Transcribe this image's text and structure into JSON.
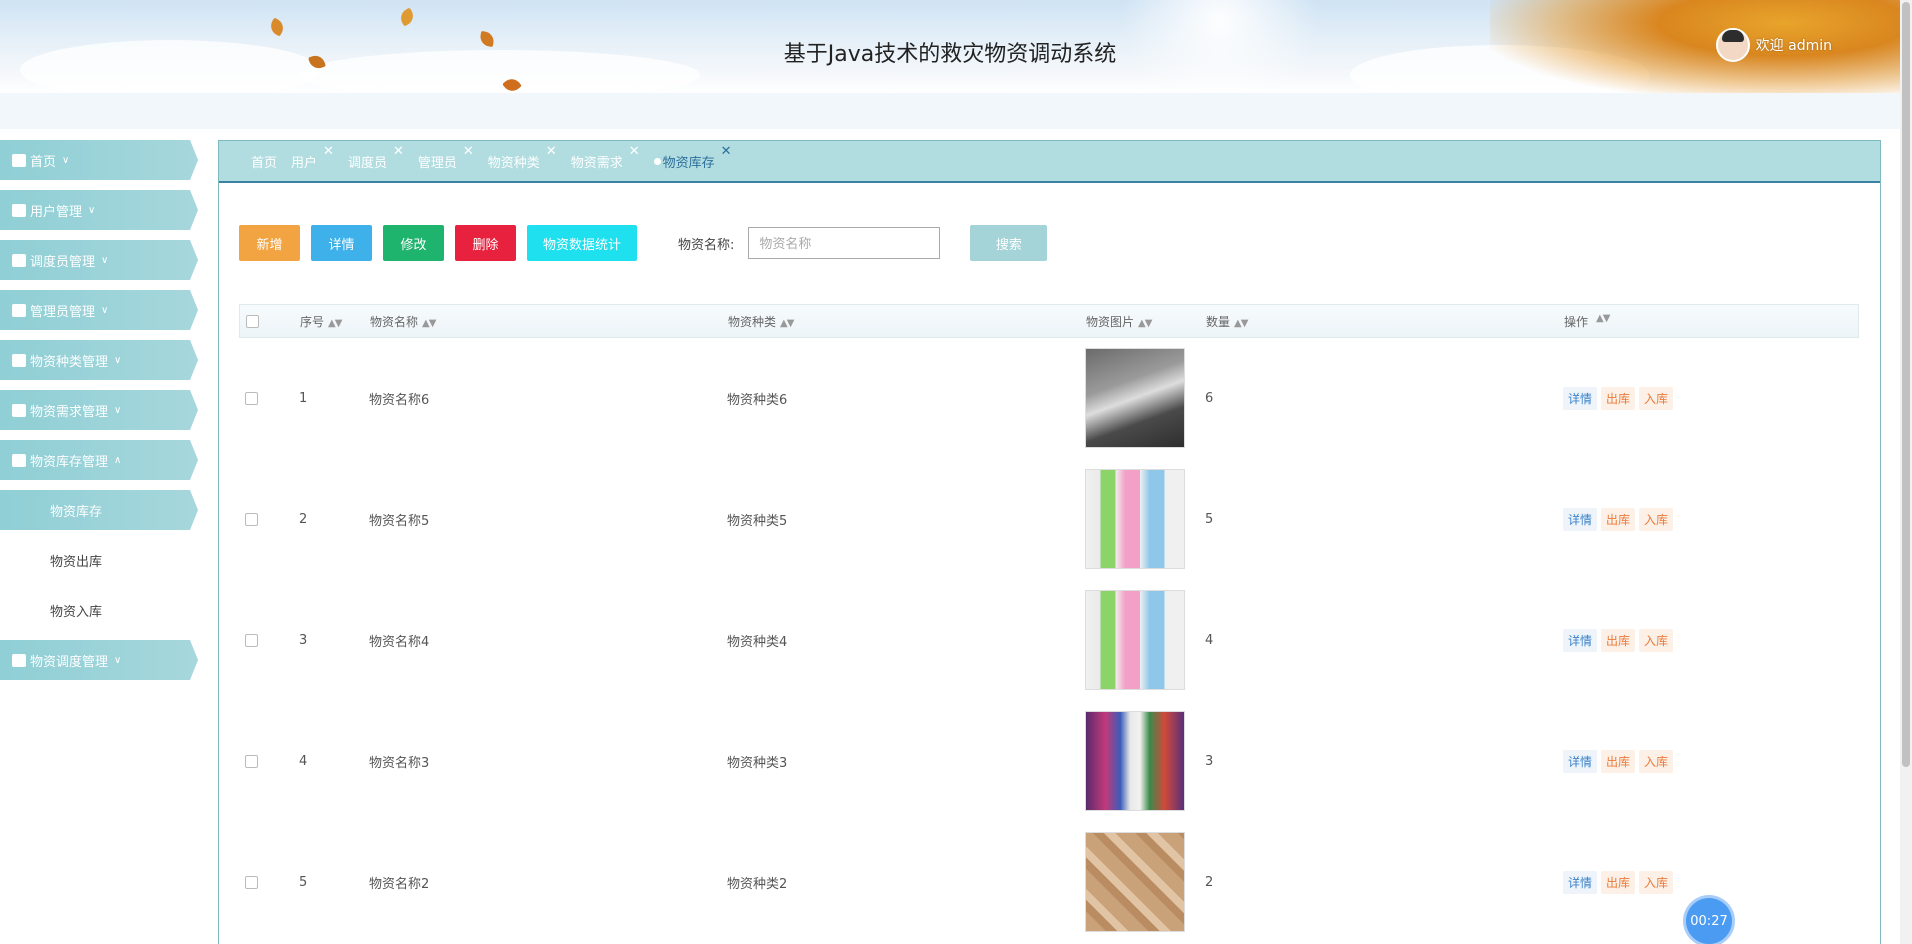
{
  "app": {
    "title": "基于Java技术的救灾物资调动系统",
    "welcome": "欢迎 admin"
  },
  "sidebar": {
    "items": [
      {
        "label": "首页",
        "icon": "home-icon",
        "arrow": "∨"
      },
      {
        "label": "用户管理",
        "icon": "user-icon",
        "arrow": "∨"
      },
      {
        "label": "调度员管理",
        "icon": "dispatcher-icon",
        "arrow": "∨"
      },
      {
        "label": "管理员管理",
        "icon": "admin-icon",
        "arrow": "∨"
      },
      {
        "label": "物资种类管理",
        "icon": "category-icon",
        "arrow": "∨"
      },
      {
        "label": "物资需求管理",
        "icon": "demand-icon",
        "arrow": "∨"
      },
      {
        "label": "物资库存管理",
        "icon": "inventory-icon",
        "arrow": "∧"
      }
    ],
    "subitems": [
      {
        "label": "物资库存"
      },
      {
        "label": "物资出库"
      },
      {
        "label": "物资入库"
      }
    ],
    "last_item": {
      "label": "物资调度管理",
      "icon": "dispatch-icon",
      "arrow": "∨"
    }
  },
  "tabs": [
    {
      "label": "首页",
      "closable": false
    },
    {
      "label": "用户",
      "closable": true
    },
    {
      "label": "调度员",
      "closable": true
    },
    {
      "label": "管理员",
      "closable": true
    },
    {
      "label": "物资种类",
      "closable": true
    },
    {
      "label": "物资需求",
      "closable": true
    },
    {
      "label": "物资库存",
      "closable": true,
      "active": true
    }
  ],
  "toolbar": {
    "add": "新增",
    "detail": "详情",
    "edit": "修改",
    "delete": "删除",
    "stats": "物资数据统计",
    "search_label": "物资名称:",
    "search_placeholder": "物资名称",
    "search_button": "搜索"
  },
  "table": {
    "headers": {
      "index": "序号",
      "name": "物资名称",
      "type": "物资种类",
      "image": "物资图片",
      "qty": "数量",
      "ops": "操作"
    },
    "rows": [
      {
        "index": "1",
        "name": "物资名称6",
        "type": "物资种类6",
        "qty": "6"
      },
      {
        "index": "2",
        "name": "物资名称5",
        "type": "物资种类5",
        "qty": "5"
      },
      {
        "index": "3",
        "name": "物资名称4",
        "type": "物资种类4",
        "qty": "4"
      },
      {
        "index": "4",
        "name": "物资名称3",
        "type": "物资种类3",
        "qty": "3"
      },
      {
        "index": "5",
        "name": "物资名称2",
        "type": "物资种类2",
        "qty": "2"
      }
    ],
    "ops": {
      "detail": "详情",
      "out": "出库",
      "in": "入库"
    }
  },
  "timer": "00:27",
  "colors": {
    "accent": "#a6d7dc",
    "tab_border": "#3a82a4",
    "add": "#f2a442",
    "detail": "#3fb1ea",
    "edit": "#1fb46d",
    "delete": "#e8213e",
    "stats": "#1ee0ee"
  }
}
